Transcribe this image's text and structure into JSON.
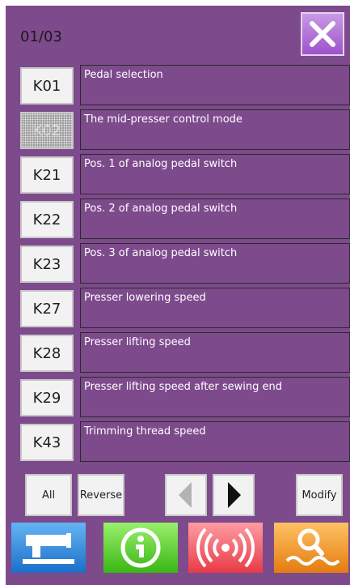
{
  "page_indicator": "01/03",
  "params": [
    {
      "code": "K01",
      "desc": "Pedal selection",
      "selected": false
    },
    {
      "code": "K02",
      "desc": "The mid-presser control mode",
      "selected": true
    },
    {
      "code": "K21",
      "desc": "Pos. 1 of analog pedal switch",
      "selected": false
    },
    {
      "code": "K22",
      "desc": "Pos. 2 of analog pedal switch",
      "selected": false
    },
    {
      "code": "K23",
      "desc": "Pos. 3 of analog pedal switch",
      "selected": false
    },
    {
      "code": "K27",
      "desc": "Presser lowering speed",
      "selected": false
    },
    {
      "code": "K28",
      "desc": "Presser lifting speed",
      "selected": false
    },
    {
      "code": "K29",
      "desc": "Presser lifting speed after sewing end",
      "selected": false
    },
    {
      "code": "K43",
      "desc": "Trimming thread speed",
      "selected": false
    }
  ],
  "buttons": {
    "all": "All",
    "reverse": "Reverse",
    "modify": "Modify"
  },
  "icons": {
    "close": "close-icon",
    "prev": "arrow-left-icon",
    "next": "arrow-right-icon",
    "sewing": "sewing-machine-icon",
    "info": "info-icon",
    "wireless": "wireless-signal-icon",
    "search": "search-icon"
  },
  "colors": {
    "background": "#7d4a8c",
    "close_button": "#b27ddc",
    "sewing_button": "#2f86dc",
    "info_button": "#52c926",
    "wireless_button": "#ee5560",
    "search_button": "#f09426"
  }
}
